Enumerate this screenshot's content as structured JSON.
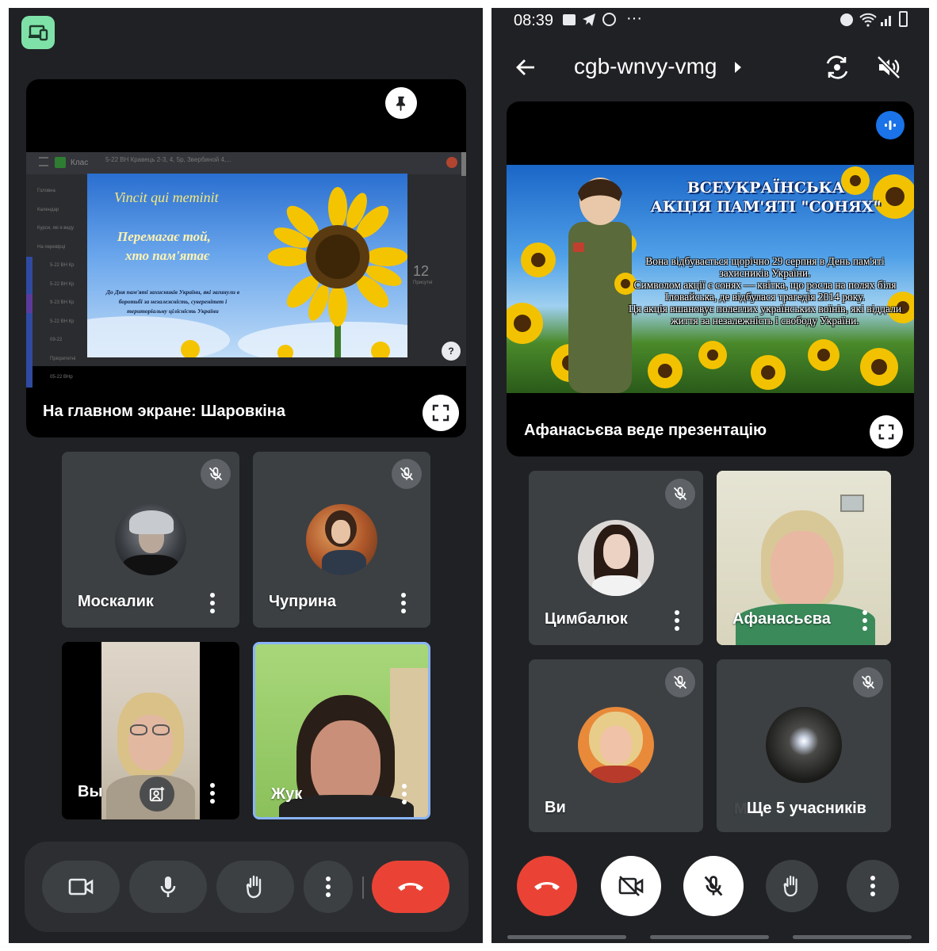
{
  "left": {
    "stage": {
      "caption": "На главном экране: Шаровкіна",
      "slide": {
        "motto": "Vincit qui meminit",
        "line1": "Перемагає той,",
        "line2": "хто пам'ятає",
        "dedication": "До Дня пам'яті захисників України, які загинули в боротьбі за незалежність, суверенітет і територіальну цілісність України"
      },
      "behind": {
        "tab_text": "Клас",
        "course_text": "5-22 ВН Кравець 2-3, 4, 5р, Звербиной 4,...",
        "sidebar": [
          "Головна",
          "Календар",
          "Курси, які я веду",
          "На перевірці",
          "5-22 ВН Кр",
          "5-22 ВН Кр",
          "9-23 ВН Кр",
          "5-22 ВН Кр",
          "09-22 Пріоритетні",
          "05-22 ВНр"
        ],
        "count": "12",
        "count_label": "Присутні"
      }
    },
    "tiles": [
      {
        "name": "Москалик"
      },
      {
        "name": "Чуприна"
      },
      {
        "name": "Вы"
      },
      {
        "name": "Жук"
      }
    ]
  },
  "right": {
    "status": {
      "time": "08:39",
      "dots": "···"
    },
    "meeting_code": "cgb-wnvy-vmg",
    "stage": {
      "caption": "Афанасьєва веде презентацію",
      "slide": {
        "title1": "ВСЕУКРАЇНСЬКА",
        "title2": "АКЦІЯ ПАМ'ЯТІ \"СОНЯХ\"",
        "p1": "Вона відбувається щорічно 29 серпня в День пам'яті захисників України.",
        "p2": "Символом акції є соняx — квітка, що росла на полях біля Іловайська, де відбулася трагедія 2014 року.",
        "p3": "Ця акція вшановує полеглих українських воїнів, які віддали життя за незалежність і свободу України."
      }
    },
    "tiles": [
      {
        "name": "Цимбалюк"
      },
      {
        "name": "Афанасьєва"
      },
      {
        "name": "Ви"
      },
      {
        "name": "Ще 5 учасників",
        "behind_name": "М"
      }
    ]
  },
  "colors": {
    "background": "#202124",
    "tile": "#3c4043",
    "end_call": "#ea4335",
    "active_speaker": "#8ab4f8",
    "cast_badge": "#7ee2a8"
  }
}
